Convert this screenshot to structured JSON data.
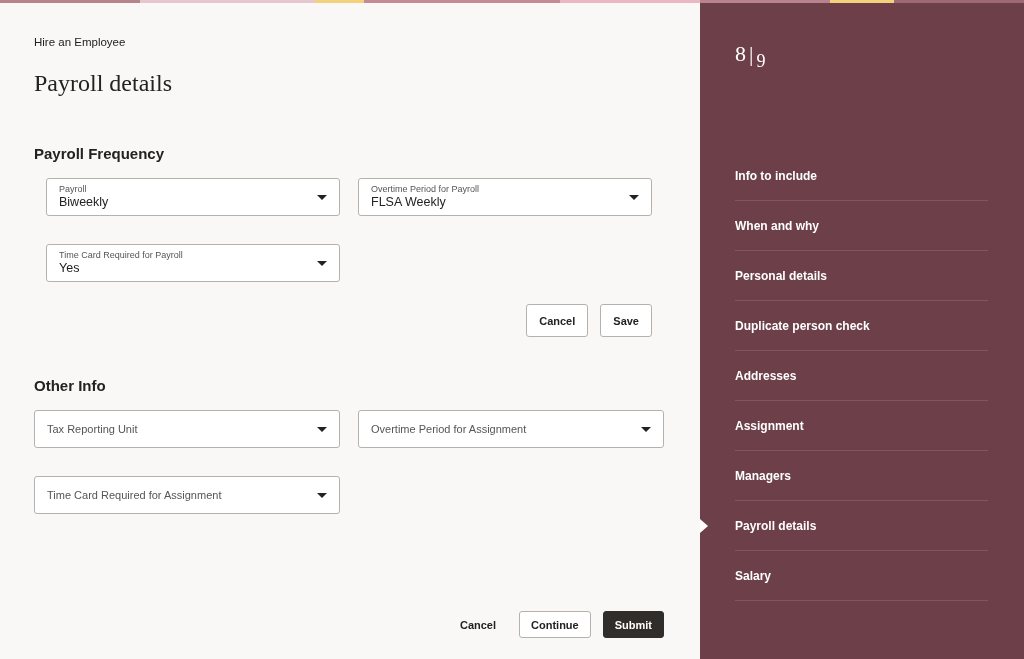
{
  "breadcrumb": "Hire an Employee",
  "title": "Payroll details",
  "sections": [
    {
      "heading": "Payroll Frequency",
      "inset": true,
      "fields": [
        {
          "label": "Payroll",
          "value": "Biweekly"
        },
        {
          "label": "Overtime Period for Payroll",
          "value": "FLSA Weekly"
        },
        {
          "label": "Time Card Required for Payroll",
          "value": "Yes"
        }
      ],
      "buttons": [
        "Cancel",
        "Save"
      ]
    },
    {
      "heading": "Other Info",
      "inset": false,
      "fields": [
        {
          "label": "Tax Reporting Unit"
        },
        {
          "label": "Overtime Period for Assignment"
        },
        {
          "label": "Time Card Required for Assignment"
        }
      ]
    }
  ],
  "footer_buttons": [
    {
      "label": "Cancel",
      "kind": "link"
    },
    {
      "label": "Continue",
      "kind": "outline"
    },
    {
      "label": "Submit",
      "kind": "primary"
    }
  ],
  "progress": {
    "current": "8",
    "separator": "|",
    "total": "9"
  },
  "steps": [
    {
      "label": "Info to include",
      "selected": false
    },
    {
      "label": "When and why",
      "selected": false
    },
    {
      "label": "Personal details",
      "selected": false
    },
    {
      "label": "Duplicate person check",
      "selected": false
    },
    {
      "label": "Addresses",
      "selected": false
    },
    {
      "label": "Assignment",
      "selected": false
    },
    {
      "label": "Managers",
      "selected": false
    },
    {
      "label": "Payroll details",
      "selected": true
    },
    {
      "label": "Salary",
      "selected": false
    }
  ]
}
